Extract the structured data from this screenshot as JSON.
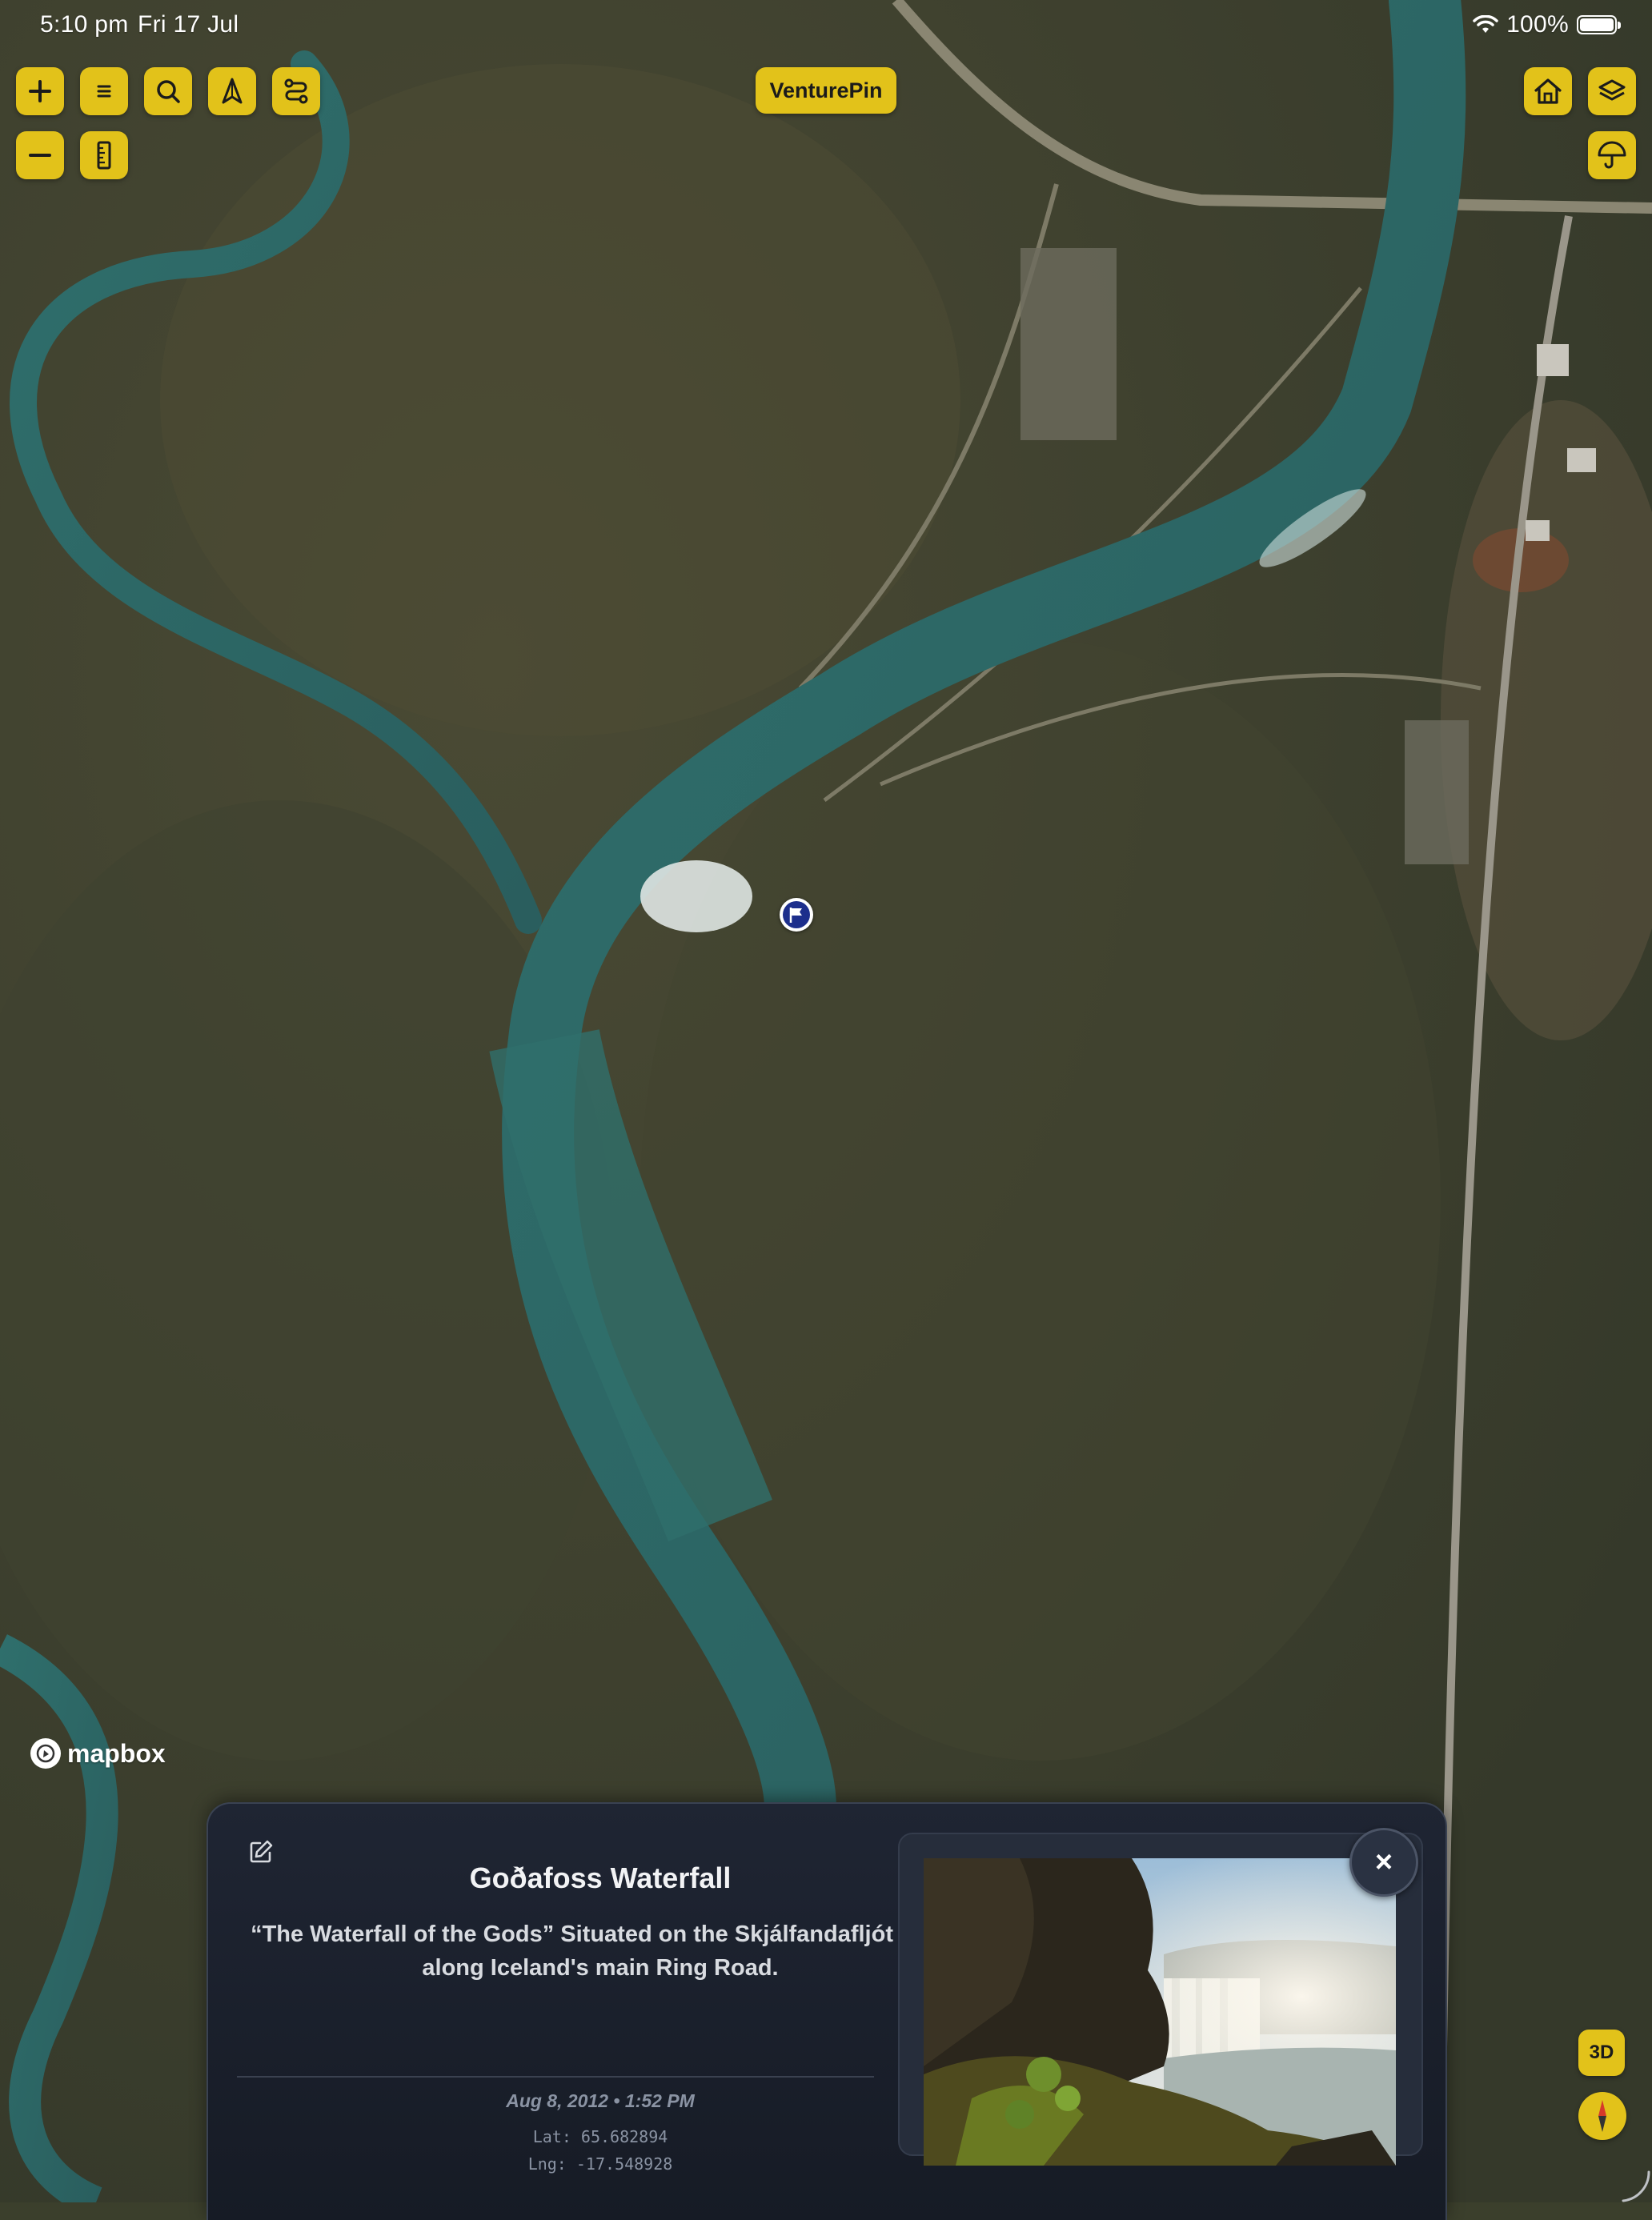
{
  "status_bar": {
    "time": "5:10 pm",
    "date": "Fri 17 Jul",
    "battery": "100%"
  },
  "app": {
    "title": "VenturePin",
    "accent_color": "#e2c21a"
  },
  "toolbar": {
    "left_top": [
      "zoom-in-icon",
      "menu-icon",
      "search-icon",
      "navigation-arrow-icon",
      "route-icon"
    ],
    "left_bottom": [
      "zoom-out-icon",
      "ruler-icon"
    ],
    "right_top": [
      "home-icon",
      "layers-icon"
    ],
    "right_bottom": [
      "umbrella-icon"
    ]
  },
  "map": {
    "attribution": "mapbox",
    "view_mode_button": "3D"
  },
  "info_card": {
    "title": "Goðafoss Waterfall",
    "description": "“The Waterfall of the Gods” Situated on the Skjálfandafljót river along Iceland's main Ring Road.",
    "date": "Aug 8, 2012 • 1:52 PM",
    "lat": "Lat: 65.682894",
    "lng": "Lng: -17.548928",
    "close_label": "×"
  }
}
